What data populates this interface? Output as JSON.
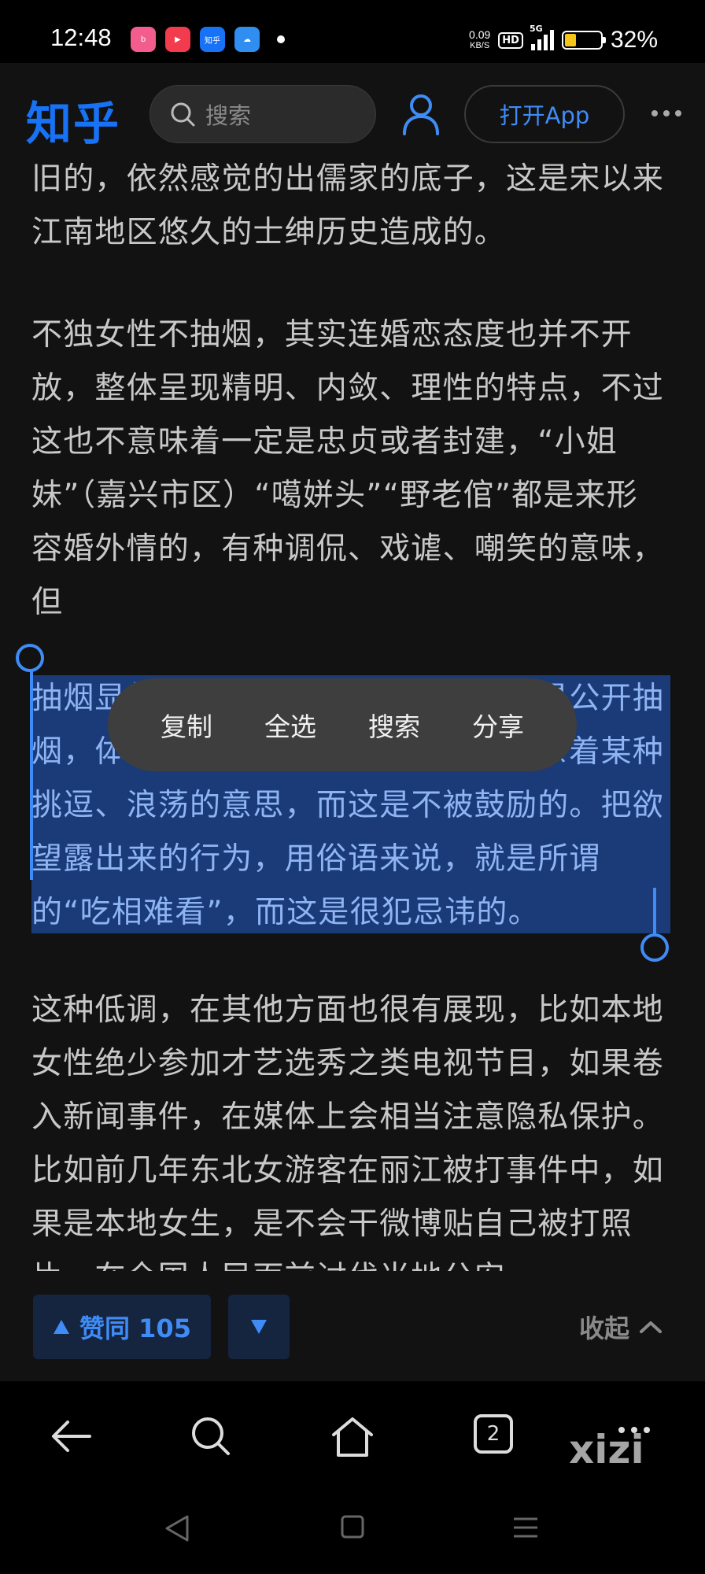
{
  "status_bar": {
    "time": "12:48",
    "speed_value": "0.09",
    "speed_unit": "KB/S",
    "hd": "HD",
    "network": "5G",
    "battery": "32%",
    "battery_level": 0.32,
    "app_icons": [
      "bilibili-icon",
      "video-icon",
      "zhihu-icon",
      "weather-icon"
    ],
    "zhihu_mini": "知乎"
  },
  "header": {
    "logo": "知乎",
    "search_placeholder": "搜索",
    "open_app": "打开App"
  },
  "article": {
    "p1": "旧的，依然感觉的出儒家的底子，这是宋以来江南地区悠久的士绅历史造成的。",
    "p2": "不独女性不抽烟，其实连婚恋态度也并不开放，整体呈现精明、内敛、理性的特点，不过这也不意味着一定是忠贞或者封建，“小姐妹”（嘉兴市区）“噶姘头”“野老倌”都是来形容婚外情的，有种调侃、戏谑、嘲笑的意味，但",
    "p3_selected": "抽烟显然是一种张扬，女性抽烟尤其是公开抽烟，体现了一种当众表露的原欲，混杂着某种挑逗、浪荡的意思，而这是不被鼓励的。把欲望露出来的行为，用俗语来说，就是所谓的“吃相难看”，而这是很犯忌讳的。",
    "p4": "这种低调，在其他方面也很有展现，比如本地女性绝少参加才艺选秀之类电视节目，如果卷入新闻事件，在媒体上会相当注意隐私保护。比如前几年东北女游客在丽江被打事件中，如果是本地女生，是不会干微博贴自己被打照片，在全国人民面前讨伐当地公安"
  },
  "context_menu": [
    "复制",
    "全选",
    "搜索",
    "分享"
  ],
  "vote": {
    "up_label": "赞同 105",
    "collapse_label": "收起"
  },
  "browser_nav": {
    "tab_count": "2",
    "watermark": "xizi"
  }
}
